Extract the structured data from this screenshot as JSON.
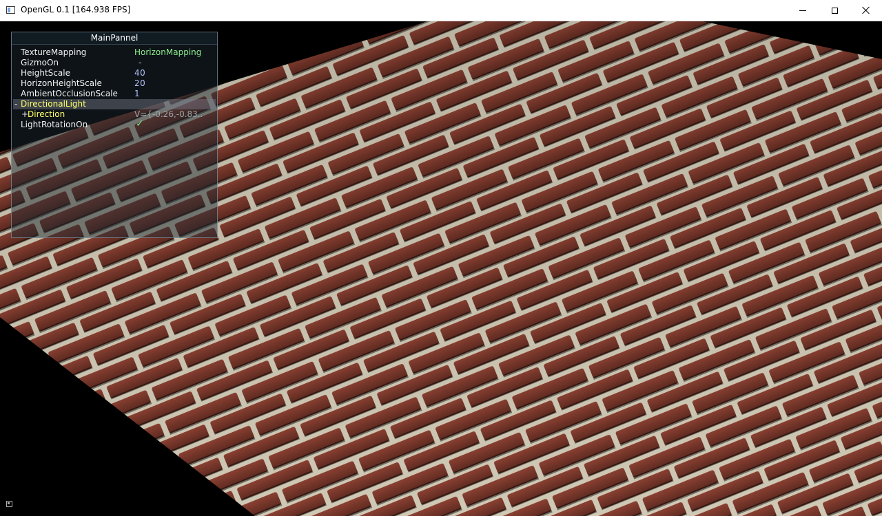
{
  "window": {
    "title": "OpenGL 0.1 [164.938 FPS]",
    "icon": "app-window-icon"
  },
  "panel": {
    "title": "MainPannel",
    "rows": {
      "texture_mapping": {
        "label": "TextureMapping",
        "value": "HorizonMapping"
      },
      "gizmo_on": {
        "label": "GizmoOn",
        "value": "-"
      },
      "height_scale": {
        "label": "HeightScale",
        "value": "40"
      },
      "horizon_height_scale": {
        "label": "HorizonHeightScale",
        "value": "20"
      },
      "ambient_occlusion_scale": {
        "label": "AmbientOcclusionScale",
        "value": "1"
      },
      "directional_light": {
        "label": "DirectionalLight",
        "glyph": "-"
      },
      "direction": {
        "label": "Direction",
        "glyph": "+",
        "value": "V={-0.26,-0.83.."
      },
      "light_rotation_on": {
        "label": "LightRotationOn",
        "value": "✓"
      }
    }
  },
  "colors": {
    "brick": "#7a3326",
    "mortar": "#bdb7a6",
    "panel_text": "#f2f2f2",
    "highlight": "#ffff66",
    "value_green": "#8ff08f"
  }
}
